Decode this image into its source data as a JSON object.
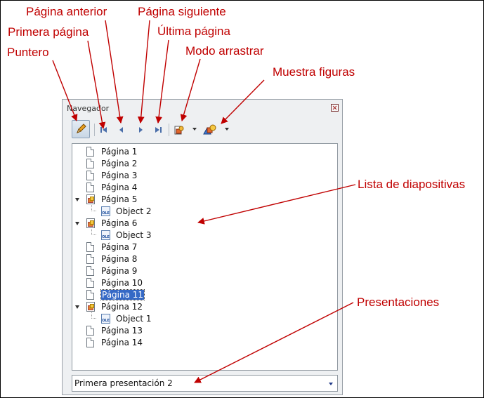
{
  "annotations": {
    "puntero": "Puntero",
    "primera_pagina": "Primera página",
    "pagina_anterior": "Página anterior",
    "pagina_siguiente": "Página siguiente",
    "ultima_pagina": "Última página",
    "modo_arrastrar": "Modo arrastrar",
    "muestra_figuras": "Muestra figuras",
    "lista_diapositivas": "Lista de diapositivas",
    "presentaciones": "Presentaciones"
  },
  "navigator": {
    "title": "Navegador",
    "toolbar": [
      "pencil-icon",
      "first-page-icon",
      "previous-page-icon",
      "next-page-icon",
      "last-page-icon",
      "drag-mode-icon",
      "shapes-icon"
    ],
    "items": [
      {
        "label": "Página 1",
        "type": "page"
      },
      {
        "label": "Página 2",
        "type": "page"
      },
      {
        "label": "Página 3",
        "type": "page"
      },
      {
        "label": "Página 4",
        "type": "page"
      },
      {
        "label": "Página 5",
        "type": "page-with-objects",
        "expanded": true
      },
      {
        "label": "Object 2",
        "type": "ole"
      },
      {
        "label": "Página 6",
        "type": "page-with-objects",
        "expanded": true
      },
      {
        "label": "Object 3",
        "type": "ole"
      },
      {
        "label": "Página 7",
        "type": "page"
      },
      {
        "label": "Página 8",
        "type": "page"
      },
      {
        "label": "Página 9",
        "type": "page"
      },
      {
        "label": "Página 10",
        "type": "page"
      },
      {
        "label": "Página 11",
        "type": "page",
        "selected": true
      },
      {
        "label": "Página 12",
        "type": "page-with-objects",
        "expanded": true
      },
      {
        "label": "Object 1",
        "type": "ole"
      },
      {
        "label": "Página 13",
        "type": "page"
      },
      {
        "label": "Página 14",
        "type": "page"
      }
    ],
    "document_select": "Primera presentación 2",
    "ole_badge": "OLE"
  },
  "colors": {
    "annotation": "#c00000",
    "selection": "#3569c6"
  }
}
